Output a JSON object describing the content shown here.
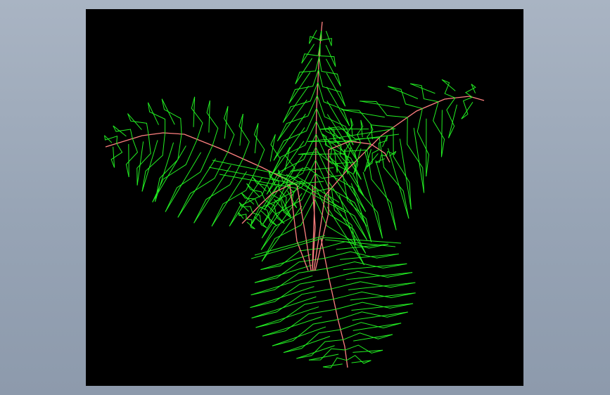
{
  "canvas": {
    "background": "#000000",
    "frame_background": "#9aa6b6"
  },
  "plant": {
    "leaf_color": "#22ee22",
    "stem_color": "#ff8080",
    "fronds": [
      {
        "name": "top-frond",
        "count_leaflet_pairs": 14
      },
      {
        "name": "left-frond",
        "count_leaflet_pairs": 12
      },
      {
        "name": "right-frond",
        "count_leaflet_pairs": 11
      },
      {
        "name": "bottom-frond",
        "count_leaflet_pairs": 12
      },
      {
        "name": "center-left-frond",
        "count_leaflet_pairs": 7
      },
      {
        "name": "center-right-frond",
        "count_leaflet_pairs": 7
      }
    ]
  }
}
